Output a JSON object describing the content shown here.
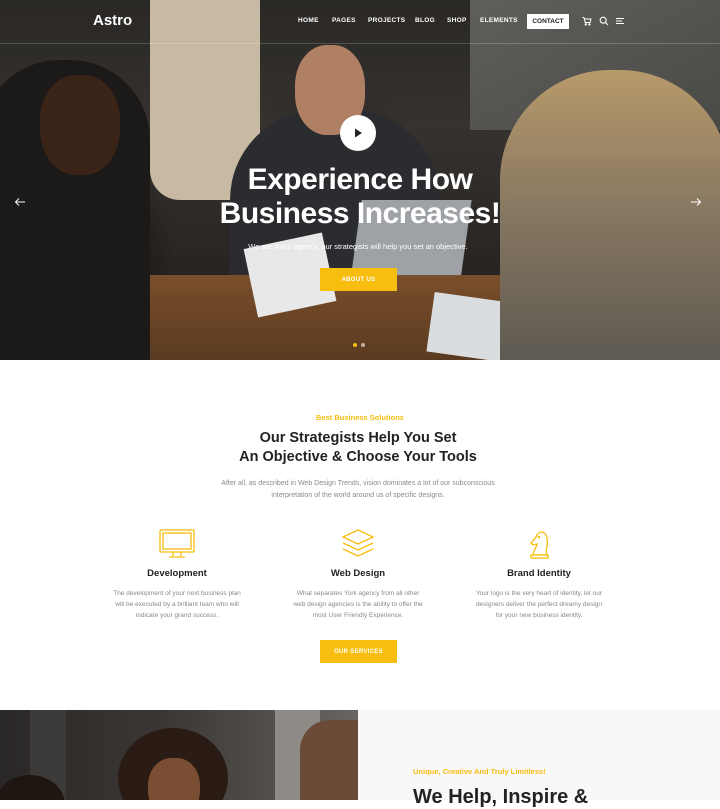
{
  "nav": {
    "logo": "Astro",
    "items": [
      "HOME",
      "PAGES",
      "PROJECTS",
      "BLOG",
      "SHOP",
      "ELEMENTS"
    ],
    "contact": "CONTACT",
    "icons": [
      "cart-icon",
      "search-icon",
      "menu-icon"
    ]
  },
  "hero": {
    "title_line1": "Experience How",
    "title_line2": "Business Increases!",
    "subtitle": "We are Astro agency, our strategists will help you set an objective.",
    "button": "ABOUT US",
    "slides": 2,
    "active_slide": 1
  },
  "services": {
    "eyebrow": "Best Business Solutions",
    "title_line1": "Our Strategists Help You Set",
    "title_line2": "An Objective & Choose Your Tools",
    "desc_line1": "After all, as described in Web Design Trends, vision dominates a lot of our subconscious",
    "desc_line2": "interpretation of the world around us of specific designs.",
    "features": [
      {
        "icon": "monitor-icon",
        "title": "Development",
        "lines": [
          "The development of your next business plan",
          "will be executed by a brilliant team who will",
          "indicate your grand success."
        ]
      },
      {
        "icon": "layers-icon",
        "title": "Web Design",
        "lines": [
          "What separates York agency from all other",
          "web design agencies is the ability to offer the",
          "most User Friendly Experience."
        ]
      },
      {
        "icon": "chess-knight-icon",
        "title": "Brand Identity",
        "lines": [
          "Your logo is the very heart of identity, let our",
          "designers deliver the perfect dreamy design",
          "for your new business identity."
        ]
      }
    ],
    "button": "OUR SERVICES"
  },
  "bottom": {
    "eyebrow": "Unique, Creative And Truly Limitless!",
    "title": "We Help, Inspire &"
  },
  "colors": {
    "accent": "#f7bd0f",
    "heading": "#222222",
    "body_text": "#8a8a8a"
  }
}
